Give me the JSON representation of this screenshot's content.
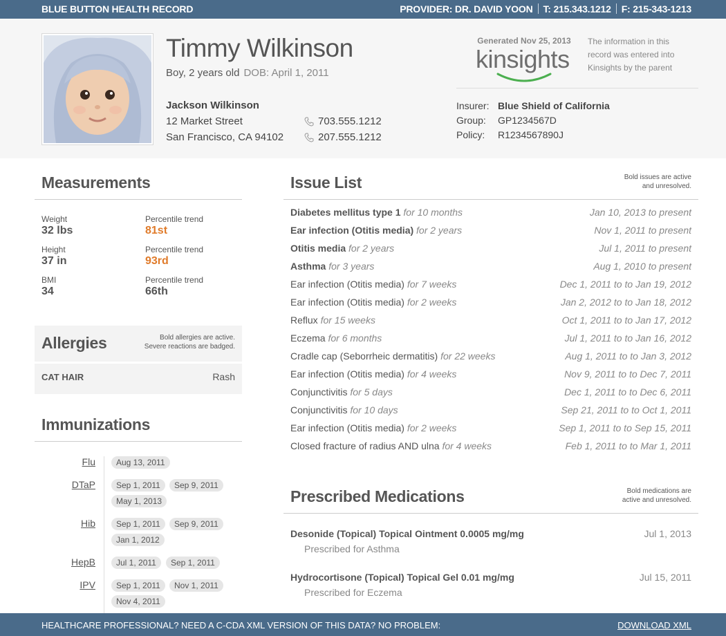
{
  "topbar": {
    "brand": "BLUE BUTTON HEALTH RECORD",
    "provider": "PROVIDER:  DR. DAVID YOON",
    "phone": "T: 215.343.1212",
    "fax": "F: 215-343-1213"
  },
  "patient": {
    "name": "Timmy Wilkinson",
    "summary": "Boy, 2 years old",
    "dob": "DOB: April 1, 2011"
  },
  "guardian": {
    "name": "Jackson Wilkinson",
    "street": "12 Market Street",
    "city": "San Francisco, CA 94102",
    "phone1": "703.555.1212",
    "phone2": "207.555.1212"
  },
  "source": {
    "generated": "Generated Nov 25, 2013",
    "logo": "kinsights",
    "notice": "The information in this record was entered into Kinsights by the parent"
  },
  "insurance": {
    "insurer_label": "Insurer:",
    "insurer": "Blue Shield of California",
    "group_label": "Group:",
    "group": "GP1234567D",
    "policy_label": "Policy:",
    "policy": "R1234567890J"
  },
  "measurements": {
    "title": "Measurements",
    "items": [
      {
        "label": "Weight",
        "value": "32 lbs"
      },
      {
        "label": "Percentile trend",
        "value": "81st"
      },
      {
        "label": "Height",
        "value": "37 in"
      },
      {
        "label": "Percentile trend",
        "value": "93rd"
      },
      {
        "label": "BMI",
        "value": "34"
      },
      {
        "label": "Percentile trend",
        "value": "66th"
      }
    ]
  },
  "allergies": {
    "title": "Allergies",
    "note_line1": "Bold allergies are active.",
    "note_line2": "Severe reactions are badged.",
    "items": [
      {
        "name": "CAT HAIR",
        "reaction": "Rash"
      }
    ]
  },
  "immunizations": {
    "title": "Immunizations",
    "items": [
      {
        "name": "Flu",
        "dates": [
          "Aug 13, 2011"
        ]
      },
      {
        "name": "DTaP",
        "dates": [
          "Sep 1, 2011",
          "Sep 9, 2011",
          "May 1, 2013"
        ]
      },
      {
        "name": "Hib",
        "dates": [
          "Sep 1, 2011",
          "Sep 9, 2011",
          "Jan 1, 2012"
        ]
      },
      {
        "name": "HepB",
        "dates": [
          "Jul 1, 2011",
          "Sep 1, 2011"
        ]
      },
      {
        "name": "IPV",
        "dates": [
          "Sep 1, 2011",
          "Nov 1, 2011",
          "Nov 4, 2011"
        ]
      }
    ]
  },
  "issues": {
    "title": "Issue List",
    "note_line1": "Bold issues are active",
    "note_line2": "and unresolved.",
    "items": [
      {
        "name": "Diabetes mellitus type 1",
        "duration": "for 10 months",
        "dates": "Jan 10, 2013 to present",
        "active": true
      },
      {
        "name": "Ear infection (Otitis media)",
        "duration": "for 2 years",
        "dates": "Nov 1, 2011 to present",
        "active": true
      },
      {
        "name": "Otitis media",
        "duration": "for 2 years",
        "dates": "Jul 1, 2011 to present",
        "active": true
      },
      {
        "name": "Asthma",
        "duration": "for 3 years",
        "dates": "Aug 1, 2010 to present",
        "active": true
      },
      {
        "name": "Ear infection (Otitis media)",
        "duration": "for 7 weeks",
        "dates": "Dec 1, 2011 to to Jan 19, 2012",
        "active": false
      },
      {
        "name": "Ear infection (Otitis media)",
        "duration": "for 2 weeks",
        "dates": "Jan 2, 2012 to to Jan 18, 2012",
        "active": false
      },
      {
        "name": "Reflux",
        "duration": "for 15 weeks",
        "dates": "Oct 1, 2011 to to Jan 17, 2012",
        "active": false
      },
      {
        "name": "Eczema",
        "duration": "for 6 months",
        "dates": "Jul 1, 2011 to to Jan 16, 2012",
        "active": false
      },
      {
        "name": "Cradle cap (Seborrheic dermatitis)",
        "duration": "for 22 weeks",
        "dates": "Aug 1, 2011 to to Jan 3, 2012",
        "active": false
      },
      {
        "name": "Ear infection (Otitis media)",
        "duration": "for 4 weeks",
        "dates": "Nov 9, 2011 to to Dec 7, 2011",
        "active": false
      },
      {
        "name": "Conjunctivitis",
        "duration": "for 5 days",
        "dates": "Dec 1, 2011 to to Dec 6, 2011",
        "active": false
      },
      {
        "name": "Conjunctivitis",
        "duration": "for 10 days",
        "dates": "Sep 21, 2011 to to Oct 1, 2011",
        "active": false
      },
      {
        "name": "Ear infection (Otitis media)",
        "duration": "for 2 weeks",
        "dates": "Sep 1, 2011 to to Sep 15, 2011",
        "active": false
      },
      {
        "name": "Closed fracture of radius AND ulna",
        "duration": "for 4 weeks",
        "dates": "Feb 1, 2011 to to Mar 1, 2011",
        "active": false
      }
    ]
  },
  "medications": {
    "title": "Prescribed Medications",
    "note_line1": "Bold medications are",
    "note_line2": "active and unresolved.",
    "items": [
      {
        "name": "Desonide (Topical) Topical Ointment 0.0005 mg/mg",
        "for": "Prescribed for Asthma",
        "date": "Jul 1, 2013"
      },
      {
        "name": "Hydrocortisone (Topical) Topical Gel 0.01 mg/mg",
        "for": "Prescribed for Eczema",
        "date": "Jul 15, 2011"
      }
    ]
  },
  "footer": {
    "text": "HEALTHCARE PROFESSIONAL? NEED A C-CDA XML VERSION OF THIS DATA? NO PROBLEM:",
    "link": "DOWNLOAD XML"
  },
  "colors": {
    "bar": "#4a6b8a",
    "percentile_highlight": "#e07b2a",
    "logo_smile": "#4caf50"
  }
}
